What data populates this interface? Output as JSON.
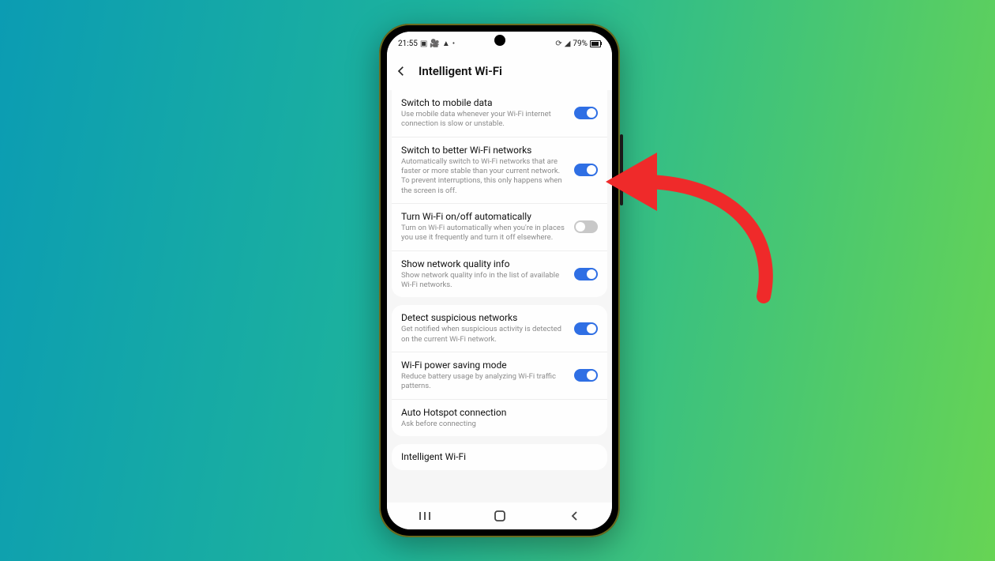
{
  "status": {
    "time": "21:55",
    "left_icons": [
      "▣",
      "🎥",
      "▲",
      "•"
    ],
    "right_icons": [
      "⟳",
      "◢"
    ],
    "battery": "79%"
  },
  "header": {
    "title": "Intelligent Wi-Fi"
  },
  "groups": [
    {
      "rows": [
        {
          "title": "Switch to mobile data",
          "desc": "Use mobile data whenever your Wi-Fi internet connection is slow or unstable.",
          "toggle": "on"
        },
        {
          "title": "Switch to better Wi-Fi networks",
          "desc": "Automatically switch to Wi-Fi networks that are faster or more stable than your current network. To prevent interruptions, this only happens when the screen is off.",
          "toggle": "on",
          "highlight": true
        },
        {
          "title": "Turn Wi-Fi on/off automatically",
          "desc": "Turn on Wi-Fi automatically when you're in places you use it frequently and turn it off elsewhere.",
          "toggle": "off"
        },
        {
          "title": "Show network quality info",
          "desc": "Show network quality info in the list of available Wi-Fi networks.",
          "toggle": "on"
        }
      ]
    },
    {
      "rows": [
        {
          "title": "Detect suspicious networks",
          "desc": "Get notified when suspicious activity is detected on the current Wi-Fi network.",
          "toggle": "on"
        },
        {
          "title": "Wi-Fi power saving mode",
          "desc": "Reduce battery usage by analyzing Wi-Fi traffic patterns.",
          "toggle": "on"
        },
        {
          "title": "Auto Hotspot connection",
          "desc": "Ask before connecting",
          "toggle": null
        }
      ]
    },
    {
      "rows": [
        {
          "title": "Intelligent Wi-Fi",
          "desc": "",
          "toggle": null
        }
      ]
    }
  ],
  "colors": {
    "toggle_on": "#2f6fe4",
    "toggle_off": "#c8c8c8",
    "arrow": "#ef2a2a"
  }
}
